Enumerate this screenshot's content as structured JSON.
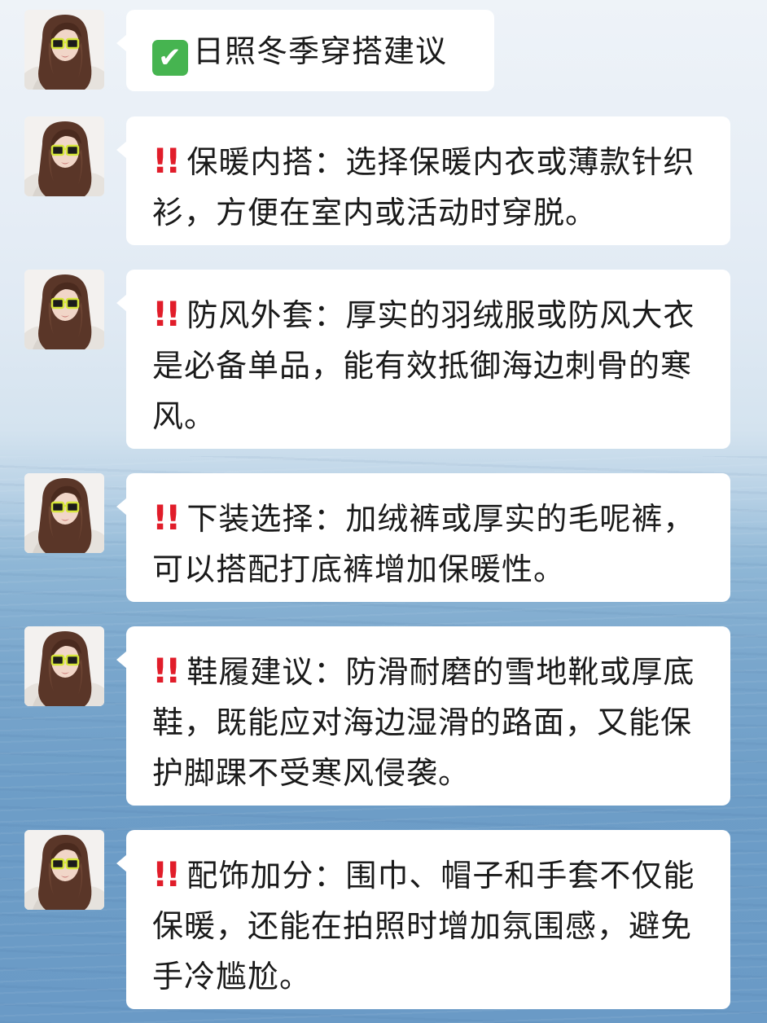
{
  "messages": [
    {
      "icon": "check-mark-emoji",
      "text": "日照冬季穿搭建议"
    },
    {
      "icon": "double-exclamation-emoji",
      "text": "保暖内搭：选择保暖内衣或薄款针织衫，方便在室内或活动时穿脱。"
    },
    {
      "icon": "double-exclamation-emoji",
      "text": "防风外套：厚实的羽绒服或防风大衣是必备单品，能有效抵御海边刺骨的寒风。"
    },
    {
      "icon": "double-exclamation-emoji",
      "text": "下装选择：加绒裤或厚实的毛呢裤，可以搭配打底裤增加保暖性。"
    },
    {
      "icon": "double-exclamation-emoji",
      "text": "鞋履建议：防滑耐磨的雪地靴或厚底鞋，既能应对海边湿滑的路面，又能保护脚踝不受寒风侵袭。"
    },
    {
      "icon": "double-exclamation-emoji",
      "text": "配饰加分：围巾、帽子和手套不仅能保暖，还能在拍照时增加氛围感，避免手冷尴尬。"
    }
  ],
  "emoji": {
    "check": "✔",
    "bang": "!!"
  },
  "colors": {
    "bubble": "#ffffff",
    "check_green": "#46b450",
    "bang_red": "#e11d2a",
    "text": "#1a1a1a",
    "sunglasses": "#d6e63a"
  }
}
